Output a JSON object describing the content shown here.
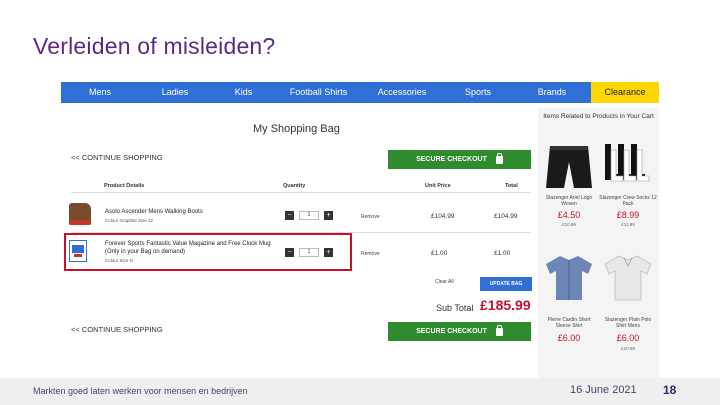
{
  "slide": {
    "title": "Verleiden of misleiden?",
    "footer_text": "Markten goed laten werken voor mensen en bedrijven",
    "date": "16 June 2021",
    "page_number": "18"
  },
  "nav": {
    "items": [
      "Mens",
      "Ladies",
      "Kids",
      "Football Shirts",
      "Accessories",
      "Sports",
      "Brands",
      "Clearance"
    ],
    "active_color": "#ffd600",
    "bar_color": "#2f6fd6"
  },
  "bag": {
    "title": "My Shopping Bag",
    "continue_label": "<< CONTINUE SHOPPING",
    "checkout_label": "SECURE CHECKOUT",
    "headers": {
      "product": "Product Details",
      "quantity": "Quantity",
      "unit_price": "Unit Price",
      "total": "Total"
    },
    "items": [
      {
        "name": "Asolo Ascender Mens Walking Boots",
        "meta": "Colour Graphite   Size 12",
        "qty": "1",
        "remove": "Remove",
        "unit_price": "£104.99",
        "total": "£104.99",
        "icon": "boot-icon"
      },
      {
        "name": "Forever Sports Fantastic Value Magazine and Free Clock Mug (Only in your Bag on demand)",
        "meta": "Colour   Size N",
        "qty": "1",
        "remove": "Remove",
        "unit_price": "£1.00",
        "total": "£1.00",
        "icon": "magazine-icon"
      }
    ],
    "clear_all": "Clear All",
    "update_label": "UPDATE BAG",
    "subtotal_label": "Sub Total",
    "subtotal_value": "£185.99",
    "highlight_color": "#c8102e"
  },
  "related": {
    "title": "Items Related to Products in Your Cart",
    "items": [
      {
        "name": "Slazenger Ariel Logo Woven",
        "price": "£4.50",
        "old": "£10.99",
        "icon": "shorts-icon"
      },
      {
        "name": "Slazenger Crew Socks 12 Pack",
        "price": "£8.99",
        "old": "£11.99",
        "icon": "socks-icon"
      },
      {
        "name": "Pierre Cardin Short Sleeve Shirt",
        "price": "£6.00",
        "old": "",
        "icon": "shirt-icon"
      },
      {
        "name": "Slazenger Plain Polo Shirt Mens",
        "price": "£6.00",
        "old": "£10.99",
        "icon": "polo-icon"
      }
    ]
  }
}
